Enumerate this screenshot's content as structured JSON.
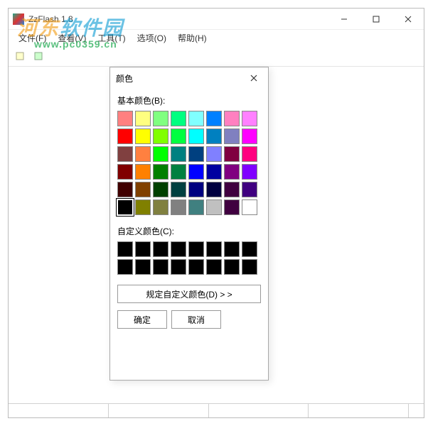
{
  "window": {
    "title": "ZzFlash 1.8",
    "menu": [
      "文件(F)",
      "查看(V)",
      "工具(T)",
      "选项(O)",
      "帮助(H)"
    ]
  },
  "watermark": {
    "cn_prefix": "河东",
    "cn_suffix": "软件园",
    "url": "www.pc0359.cn"
  },
  "color_dialog": {
    "title": "颜色",
    "basic_label": "基本颜色(B):",
    "custom_label": "自定义颜色(C):",
    "define_btn": "规定自定义颜色(D) > >",
    "ok": "确定",
    "cancel": "取消",
    "basic_colors": [
      "#ff8080",
      "#ffff80",
      "#80ff80",
      "#00ff80",
      "#80ffff",
      "#0080ff",
      "#ff80c0",
      "#ff80ff",
      "#ff0000",
      "#ffff00",
      "#80ff00",
      "#00ff40",
      "#00ffff",
      "#0080c0",
      "#8080c0",
      "#ff00ff",
      "#804040",
      "#ff8040",
      "#00ff00",
      "#008080",
      "#004080",
      "#8080ff",
      "#800040",
      "#ff0080",
      "#800000",
      "#ff8000",
      "#008000",
      "#008040",
      "#0000ff",
      "#0000a0",
      "#800080",
      "#8000ff",
      "#400000",
      "#804000",
      "#004000",
      "#004040",
      "#000080",
      "#000040",
      "#400040",
      "#400080",
      "#000000",
      "#808000",
      "#808040",
      "#808080",
      "#408080",
      "#c0c0c0",
      "#400040",
      "#ffffff"
    ],
    "selected_index": 40,
    "custom_colors": [
      "#000000",
      "#000000",
      "#000000",
      "#000000",
      "#000000",
      "#000000",
      "#000000",
      "#000000",
      "#000000",
      "#000000",
      "#000000",
      "#000000",
      "#000000",
      "#000000",
      "#000000",
      "#000000"
    ]
  }
}
